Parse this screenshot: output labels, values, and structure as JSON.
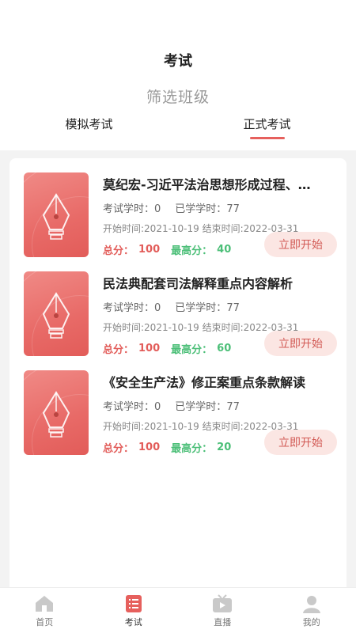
{
  "header": {
    "title": "考试"
  },
  "filter": {
    "label": "筛选班级"
  },
  "tabs": [
    {
      "label": "模拟考试",
      "active": false
    },
    {
      "label": "正式考试",
      "active": true
    }
  ],
  "exams": [
    {
      "title": "莫纪宏-习近平法治思想形成过程、…",
      "exam_hours_label": "考试学时：",
      "exam_hours": "0",
      "studied_label": "已学学时：",
      "studied": "77",
      "start_label": "开始时间:",
      "start": "2021-10-19",
      "end_label": "结束时间:",
      "end": "2022-03-31",
      "total_label": "总分：",
      "total": "100",
      "best_label": "最高分：",
      "best": "40",
      "button": "立即开始"
    },
    {
      "title": "民法典配套司法解释重点内容解析",
      "exam_hours_label": "考试学时：",
      "exam_hours": "0",
      "studied_label": "已学学时：",
      "studied": "77",
      "start_label": "开始时间:",
      "start": "2021-10-19",
      "end_label": "结束时间:",
      "end": "2022-03-31",
      "total_label": "总分：",
      "total": "100",
      "best_label": "最高分：",
      "best": "60",
      "button": "立即开始"
    },
    {
      "title": "《安全生产法》修正案重点条款解读",
      "exam_hours_label": "考试学时：",
      "exam_hours": "0",
      "studied_label": "已学学时：",
      "studied": "77",
      "start_label": "开始时间:",
      "start": "2021-10-19",
      "end_label": "结束时间:",
      "end": "2022-03-31",
      "total_label": "总分：",
      "total": "100",
      "best_label": "最高分：",
      "best": "20",
      "button": "立即开始"
    }
  ],
  "tabbar": [
    {
      "label": "首页",
      "icon": "home-icon"
    },
    {
      "label": "考试",
      "icon": "exam-list-icon",
      "active": true
    },
    {
      "label": "直播",
      "icon": "tv-icon"
    },
    {
      "label": "我的",
      "icon": "user-icon"
    }
  ],
  "colors": {
    "accent": "#e6605d",
    "score_red": "#e25c59",
    "score_green": "#4cbf78",
    "button_bg": "#fbe6e3"
  }
}
